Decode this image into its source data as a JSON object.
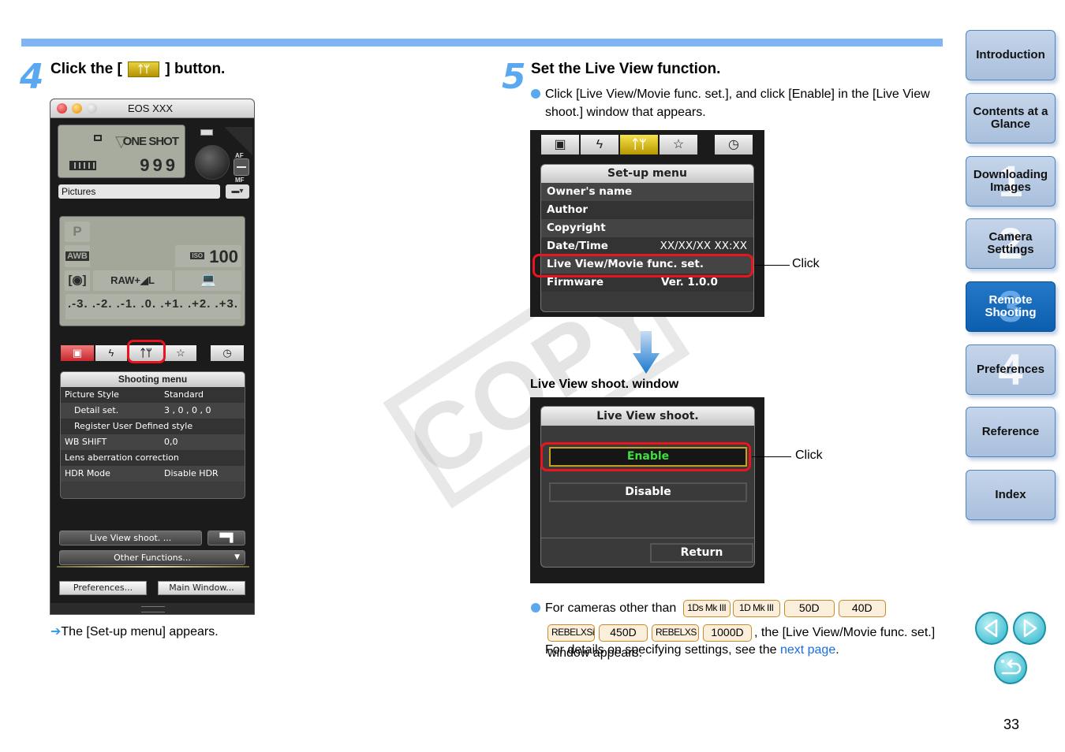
{
  "watermark": "COPY",
  "step4": {
    "number": "4",
    "title_prefix": "Click the [",
    "title_icon": "setup-tools-icon",
    "title_icon_glyph": "ᛏᛘ",
    "title_suffix": "] button.",
    "window": {
      "title": "EOS XXX",
      "lcd_top": {
        "af_mode": "ONE SHOT",
        "shots_remaining": "999"
      },
      "folder": "Pictures",
      "lcd_main": {
        "mode": "P",
        "wb": "AWB",
        "iso_label": "ISO",
        "iso": "100",
        "quality": "RAW+◢L",
        "exposure_scale": ".-3. .-2. .-1. .0. .+1. .+2. .+3."
      },
      "af_label": "AF",
      "mf_label": "MF",
      "tabs": [
        "camera",
        "flash",
        "setup",
        "star",
        "timer"
      ],
      "active_tab": "camera",
      "menu": {
        "header": "Shooting menu",
        "rows": [
          {
            "label": "Picture Style",
            "value": "Standard",
            "indent": false
          },
          {
            "label": "Detail set.",
            "value": "3 , 0 , 0 , 0",
            "indent": true
          },
          {
            "label": "Register User Defined style",
            "value": "",
            "indent": true
          },
          {
            "label": "WB SHIFT",
            "value": "0,0",
            "indent": false
          },
          {
            "label": "Lens aberration correction",
            "value": "",
            "indent": false
          },
          {
            "label": "HDR Mode",
            "value": "Disable HDR",
            "indent": false
          }
        ]
      },
      "buttons": {
        "live_view": "Live View shoot. ...",
        "movie_icon": "movie-camera-icon",
        "other_functions": "Other Functions...",
        "preferences": "Preferences...",
        "main_window": "Main Window..."
      }
    },
    "result_arrow": "➔",
    "result": "The [Set-up menu] appears."
  },
  "step5": {
    "number": "5",
    "title": "Set the Live View function.",
    "instruction": "Click [Live View/Movie func. set.], and click [Enable] in the [Live View shoot.] window that appears.",
    "setup_panel": {
      "tabs": [
        "camera",
        "flash",
        "setup",
        "star",
        "timer"
      ],
      "active_tab": "setup",
      "header": "Set-up menu",
      "rows": [
        {
          "label": "Owner's name",
          "value": ""
        },
        {
          "label": "Author",
          "value": ""
        },
        {
          "label": "Copyright",
          "value": ""
        },
        {
          "label": "Date/Time",
          "value": "XX/XX/XX XX:XX"
        },
        {
          "label": "Live View/Movie func. set.",
          "value": ""
        },
        {
          "label": "Firmware",
          "value": "Ver. 1.0.0"
        }
      ],
      "highlighted_row": "Live View/Movie func. set.",
      "callout": "Click"
    },
    "lv_window_title": "Live View shoot. window",
    "lv_panel": {
      "header": "Live View shoot.",
      "enable": "Enable",
      "disable": "Disable",
      "return": "Return",
      "callout": "Click"
    },
    "note": {
      "prefix": "For cameras other than",
      "models": [
        "1Ds Mk III",
        "1D Mk III",
        "50D",
        "40D",
        "REBELXSi",
        "450D",
        "REBELXS",
        "1000D"
      ],
      "suffix": ", the [Live View/Movie func. set.] window appears.",
      "details_prefix": "For details on specifying settings, see the ",
      "details_link": "next page",
      "details_suffix": "."
    }
  },
  "sidebar": {
    "items": [
      {
        "label": "Introduction",
        "number": "",
        "active": false
      },
      {
        "label": "Contents at a Glance",
        "number": "",
        "active": false
      },
      {
        "label": "Downloading Images",
        "number": "1",
        "active": false
      },
      {
        "label": "Camera Settings",
        "number": "2",
        "active": false
      },
      {
        "label": "Remote Shooting",
        "number": "3",
        "active": true
      },
      {
        "label": "Preferences",
        "number": "4",
        "active": false
      },
      {
        "label": "Reference",
        "number": "",
        "active": false
      },
      {
        "label": "Index",
        "number": "",
        "active": false
      }
    ],
    "prev_icon": "previous-page-icon",
    "next_icon": "next-page-icon",
    "back_icon": "return-icon"
  },
  "page_number": "33"
}
